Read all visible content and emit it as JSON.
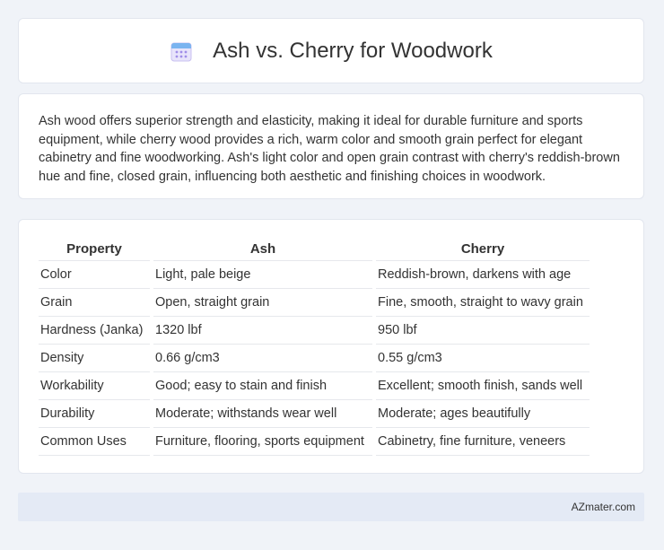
{
  "header": {
    "title": "Ash vs. Cherry for Woodwork",
    "icon": "calendar-icon"
  },
  "intro": {
    "text": "Ash wood offers superior strength and elasticity, making it ideal for durable furniture and sports equipment, while cherry wood provides a rich, warm color and smooth grain perfect for elegant cabinetry and fine woodworking. Ash's light color and open grain contrast with cherry's reddish-brown hue and fine, closed grain, influencing both aesthetic and finishing choices in woodwork."
  },
  "table": {
    "headers": [
      "Property",
      "Ash",
      "Cherry"
    ],
    "rows": [
      [
        "Color",
        "Light, pale beige",
        "Reddish-brown, darkens with age"
      ],
      [
        "Grain",
        "Open, straight grain",
        "Fine, smooth, straight to wavy grain"
      ],
      [
        "Hardness (Janka)",
        "1320 lbf",
        "950 lbf"
      ],
      [
        "Density",
        "0.66 g/cm3",
        "0.55 g/cm3"
      ],
      [
        "Workability",
        "Good; easy to stain and finish",
        "Excellent; smooth finish, sands well"
      ],
      [
        "Durability",
        "Moderate; withstands wear well",
        "Moderate; ages beautifully"
      ],
      [
        "Common Uses",
        "Furniture, flooring, sports equipment",
        "Cabinetry, fine furniture, veneers"
      ]
    ]
  },
  "footer": {
    "site": "AZmater.com"
  }
}
